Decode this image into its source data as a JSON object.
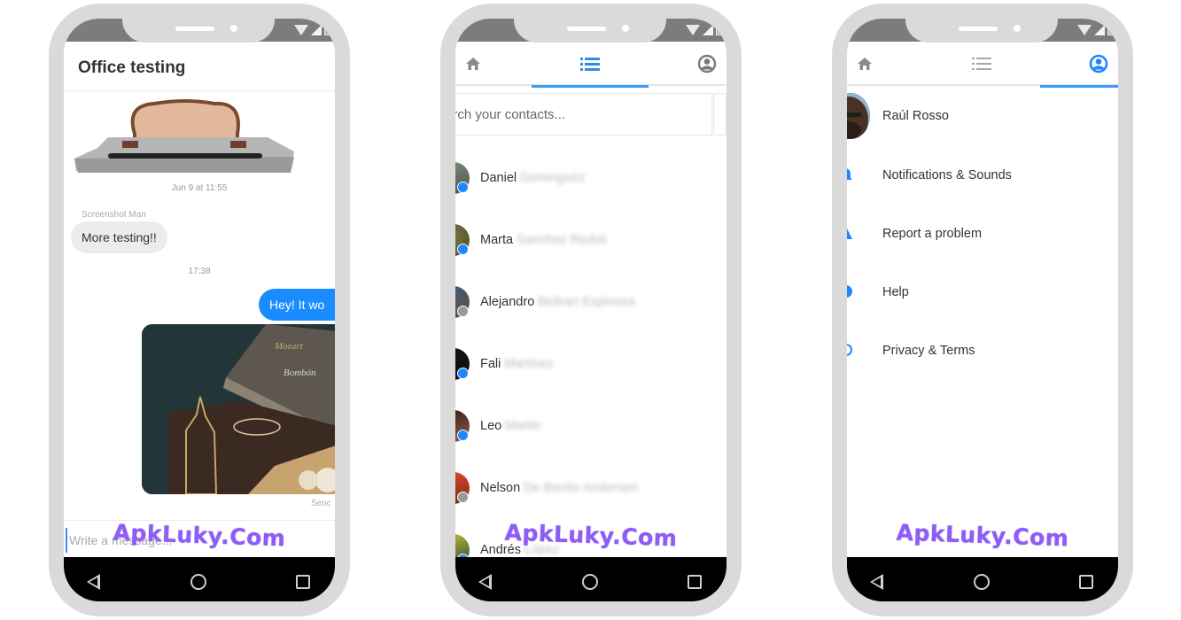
{
  "watermark": "ApkLuky.Com",
  "accent_color": "#1a8cff",
  "phones": [
    {
      "screen": "conversation",
      "chat": {
        "title": "Office testing",
        "sticker": "toast-peeking-from-toaster",
        "timestamp_1": "Jun 9 at 11:55",
        "sender_name": "Screenshot Man",
        "incoming_message": "More testing!!",
        "timestamp_2": "17:38",
        "outgoing_message": "Hey! It wo",
        "photo": "chocolate-boxes-photo",
        "sent_status": "Senc",
        "composer_placeholder": "Write a message..."
      }
    },
    {
      "screen": "contacts",
      "tabs": [
        {
          "icon": "home-icon",
          "active": false
        },
        {
          "icon": "list-icon",
          "active": true
        },
        {
          "icon": "account-icon",
          "active": false
        }
      ],
      "search_placeholder": "arch your contacts...",
      "contacts": [
        {
          "first": "Daniel",
          "last": "Dominguez",
          "source": "messenger"
        },
        {
          "first": "Marta",
          "last": "Sanchez Redoli",
          "source": "messenger"
        },
        {
          "first": "Alejandro",
          "last": "Beltran Espinosa",
          "source": "facebook"
        },
        {
          "first": "Fali",
          "last": "Martinez",
          "source": "messenger"
        },
        {
          "first": "Leo",
          "last": "Martin",
          "source": "messenger"
        },
        {
          "first": "Nelson",
          "last": "De Benito Andersen",
          "source": "facebook"
        },
        {
          "first": "Andrés",
          "last": "López",
          "source": "messenger"
        }
      ]
    },
    {
      "screen": "settings",
      "tabs": [
        {
          "icon": "home-icon",
          "active": false
        },
        {
          "icon": "list-icon",
          "active": false
        },
        {
          "icon": "account-icon",
          "active": true
        }
      ],
      "profile_name": "Raúl Rosso",
      "menu": [
        {
          "label": "Notifications & Sounds",
          "icon": "bell-icon"
        },
        {
          "label": "Report a problem",
          "icon": "warning-icon"
        },
        {
          "label": "Help",
          "icon": "help-icon"
        },
        {
          "label": "Privacy & Terms",
          "icon": "privacy-icon"
        }
      ]
    }
  ],
  "navbar": {
    "back": "back-icon",
    "home": "home-button-icon",
    "recents": "recents-icon"
  }
}
